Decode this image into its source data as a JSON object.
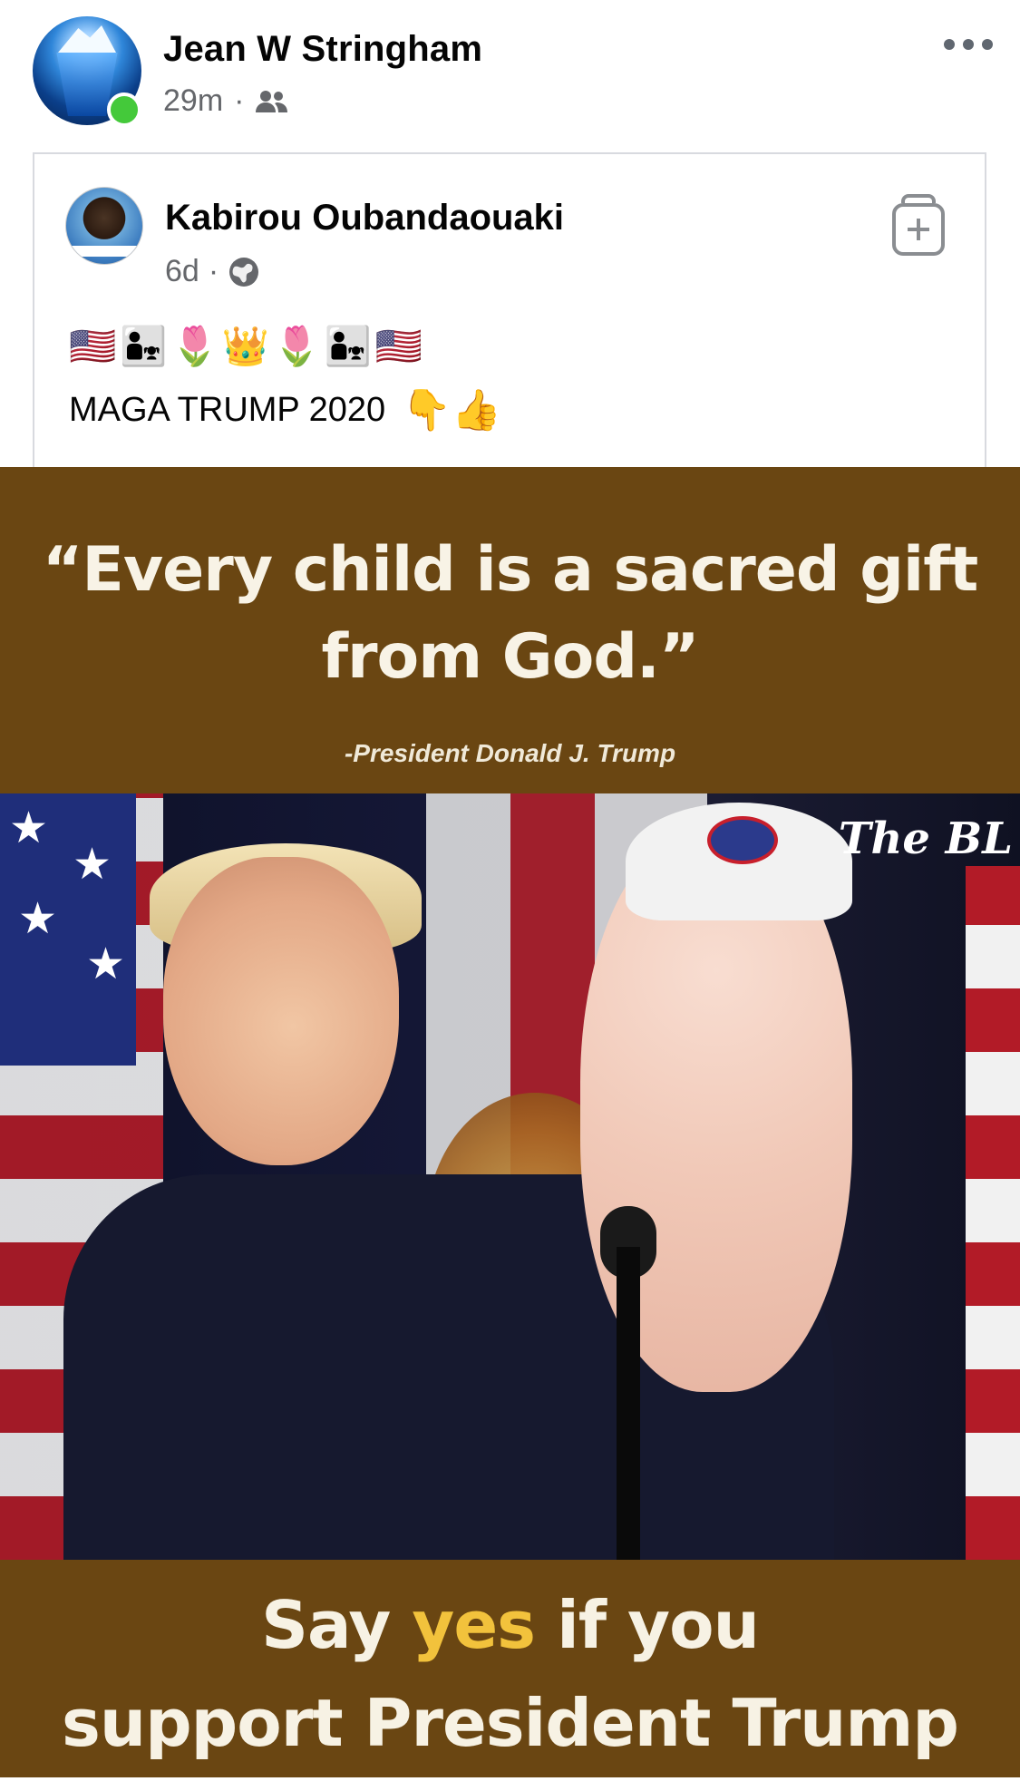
{
  "post": {
    "author": "Jean W Stringham",
    "time": "29m",
    "separator": "·",
    "audience_icon": "friends-icon",
    "more_icon": "more-horizontal-icon"
  },
  "shared": {
    "author": "Kabirou Oubandaouaki",
    "time": "6d",
    "separator": "·",
    "audience_icon": "globe-icon",
    "action_icon": "add-to-collection-icon",
    "emoji_line": "🇺🇸👨‍👧🌷👑🌷👨‍👧🇺🇸",
    "text": "MAGA TRUMP 2020",
    "text_emojis": "👇👍"
  },
  "image": {
    "quote_line1": "“Every child is a sacred gift",
    "quote_line2": "from God.”",
    "attribution": "-President Donald J. Trump",
    "watermark": "The BL",
    "cta_pre": "Say ",
    "cta_yes": "yes",
    "cta_post": " if you",
    "cta_line2": "support President Trump"
  },
  "colors": {
    "online": "#44c93a",
    "meme_brown": "#6a4612",
    "cta_highlight": "#f2c23c",
    "secondary_text": "#65676b"
  }
}
